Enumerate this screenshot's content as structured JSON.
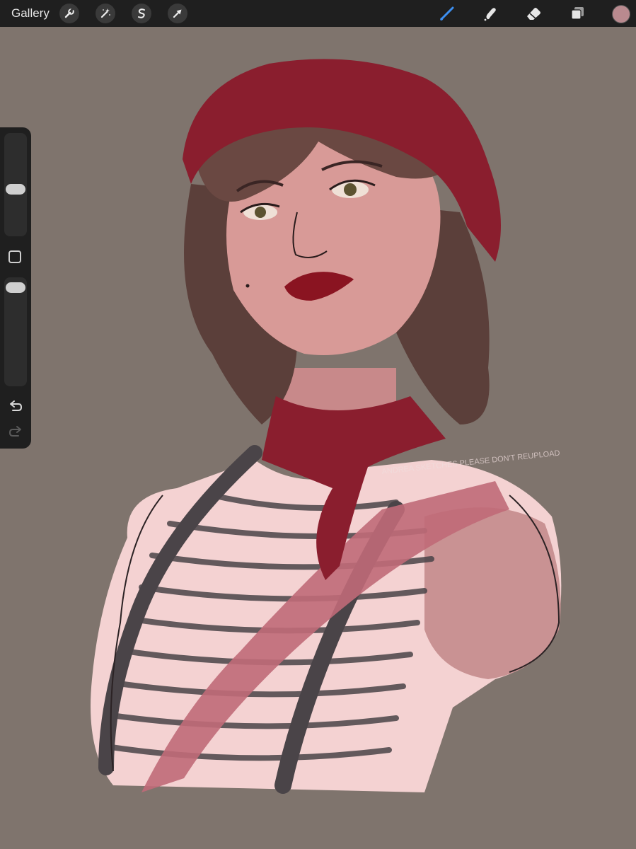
{
  "toolbar": {
    "gallery_label": "Gallery",
    "left_tools": [
      {
        "name": "actions",
        "icon": "wrench-icon"
      },
      {
        "name": "adjustments",
        "icon": "magic-wand-icon"
      },
      {
        "name": "selection",
        "icon": "selection-s-icon"
      },
      {
        "name": "transform",
        "icon": "arrow-cursor-icon"
      }
    ],
    "right_tools": [
      {
        "name": "brush",
        "icon": "brush-icon",
        "active": true
      },
      {
        "name": "smudge",
        "icon": "smudge-icon"
      },
      {
        "name": "eraser",
        "icon": "eraser-icon"
      },
      {
        "name": "layers",
        "icon": "layers-icon"
      }
    ],
    "active_color": "#b98a8f",
    "active_tool_color": "#3d8ff0"
  },
  "sidebar": {
    "brush_size": 0.55,
    "brush_opacity": 0.02,
    "undo_icon": "undo-icon",
    "redo_icon": "redo-icon"
  },
  "canvas": {
    "background_color": "#7f746d",
    "watermark": "ANDREA SKETCHES PLEASE DON'T REUPLOAD"
  }
}
